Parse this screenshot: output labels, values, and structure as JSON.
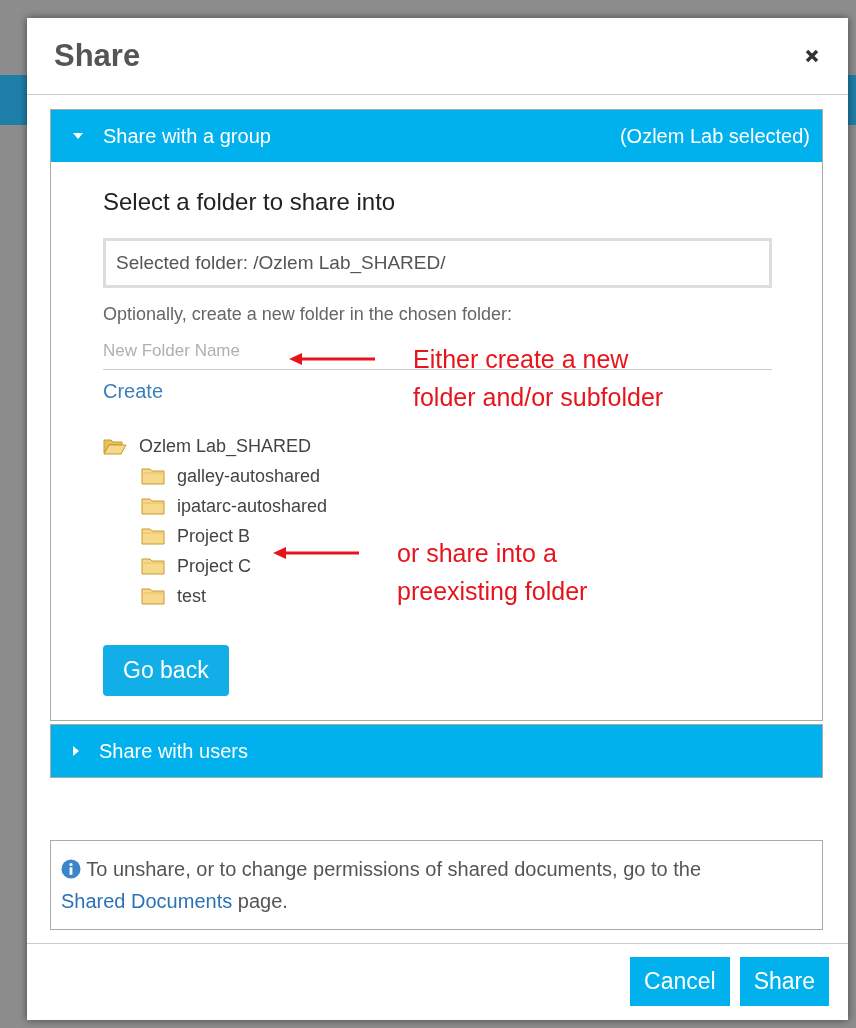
{
  "dialog": {
    "title": "Share"
  },
  "sections": [
    {
      "title": "Share with a group",
      "status": "(Ozlem Lab selected)",
      "expanded": true,
      "heading": "Select a folder to share into",
      "selected_folder": "Selected folder: /Ozlem Lab_SHARED/",
      "hint": "Optionally, create a new folder in the chosen folder:",
      "new_folder": {
        "placeholder": "New Folder Name"
      },
      "create_link": "Create",
      "tree": [
        {
          "label": "Ozlem Lab_SHARED",
          "expanded": true,
          "children": [
            {
              "label": "galley-autoshared",
              "expanded": false
            },
            {
              "label": "ipatarc-autoshared",
              "expanded": false
            },
            {
              "label": "Project B",
              "expanded": false
            },
            {
              "label": "Project C",
              "expanded": false
            },
            {
              "label": "test",
              "expanded": false
            }
          ]
        }
      ],
      "back_button": "Go back"
    },
    {
      "title": "Share with users",
      "expanded": false
    }
  ],
  "info": {
    "text": "To unshare, or to change permissions of shared documents, go to the",
    "link": "Shared Documents",
    "after": "page."
  },
  "buttons": [
    "Cancel",
    "Share"
  ],
  "annotations": [
    {
      "text": "Either create a new folder and/or subfolder"
    },
    {
      "text": "or share into a preexisting folder"
    }
  ]
}
